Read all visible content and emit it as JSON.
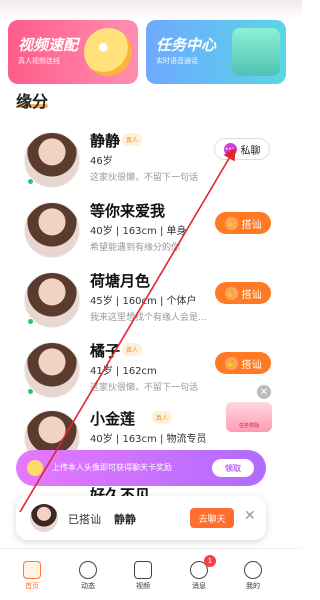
{
  "banners": [
    {
      "title": "视频速配",
      "subtitle": "真人视频连线"
    },
    {
      "title": "任务中心",
      "subtitle": "实时语音通话"
    }
  ],
  "section_title": "缘分",
  "users": [
    {
      "name": "静静",
      "tag": "真人",
      "info": "46岁",
      "desc": "这家伙很懒，不留下一句话",
      "button": "私聊"
    },
    {
      "name": "等你来爱我",
      "tag": "",
      "info": "40岁 | 163cm | 单身",
      "desc": "希望能遇到有缘分的你",
      "button": "搭讪"
    },
    {
      "name": "荷塘月色",
      "tag": "",
      "info": "45岁 | 160cm | 个体户",
      "desc": "我来这里想找个有缘人会是...",
      "button": "搭讪"
    },
    {
      "name": "橘子",
      "tag": "真人",
      "info": "41岁 | 162cm",
      "desc": "这家伙很懒，不留下一句话",
      "button": "搭讪"
    },
    {
      "name": "小金莲",
      "tag": "真人",
      "info": "40岁 | 163cm | 物流专员",
      "desc": "",
      "button": "搭讪"
    },
    {
      "name": "好久不见",
      "tag": "",
      "info": "",
      "desc": "",
      "button": ""
    }
  ],
  "gift_label": "任务奖励",
  "promo": {
    "text": "上传本人头像即可获得聊天卡奖励",
    "button": "领取",
    "close": "✕"
  },
  "accost_popup": {
    "prefix": "已搭讪",
    "name": "静静",
    "button": "去聊天",
    "close": "✕"
  },
  "tabs": [
    {
      "label": "首页",
      "active": true
    },
    {
      "label": "动态",
      "active": false
    },
    {
      "label": "视频",
      "active": false
    },
    {
      "label": "消息",
      "active": false,
      "badge": "1"
    },
    {
      "label": "我的",
      "active": false
    }
  ],
  "colors": {
    "accent": "#ff7a25",
    "promo": "#c46ff5",
    "online": "#2bc46b",
    "annotation_arrow": "#e0262f"
  }
}
